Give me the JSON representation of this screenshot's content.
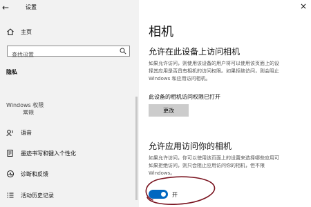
{
  "window": {
    "title": "设置",
    "close_glyph": "×"
  },
  "sidebar": {
    "home_label": "主页",
    "search": {
      "placeholder": "查找设置"
    },
    "section_title": "隐私",
    "group_label": "Windows 权限",
    "partial_item_label": "常规",
    "items": [
      {
        "label": "语音",
        "icon": "speech-icon"
      },
      {
        "label": "墨迹书写和键入个性化",
        "icon": "inking-icon"
      },
      {
        "label": "诊断和反馈",
        "icon": "diagnostics-icon"
      },
      {
        "label": "活动历史记录",
        "icon": "activity-history-icon"
      }
    ]
  },
  "main": {
    "title": "相机",
    "device_section": {
      "heading": "允许在此设备上访问相机",
      "paragraph": [
        "如果允许访问，则使用该设备的用户将可以使用该页面上的设",
        "择其应用是否具有相机的访问权限。如果拒绝访问，则会阻止",
        "Windows 和应用访问相机。"
      ],
      "status": "此设备的相机访问权限已打开",
      "change_button": "更改"
    },
    "apps_section": {
      "heading": "允许应用访问你的相机",
      "paragraph": [
        "如果允许访问，你可以使用该页面上的设置来选择哪些应用可",
        "如果拒绝访问，则只会阻止应用访问你的相机，但不限",
        "Windows。"
      ],
      "toggle_on": true,
      "toggle_label": "开"
    }
  },
  "colors": {
    "accent": "#0067c0",
    "annotation": "#7a1420",
    "sidebar_bg": "#f2f2f2"
  }
}
